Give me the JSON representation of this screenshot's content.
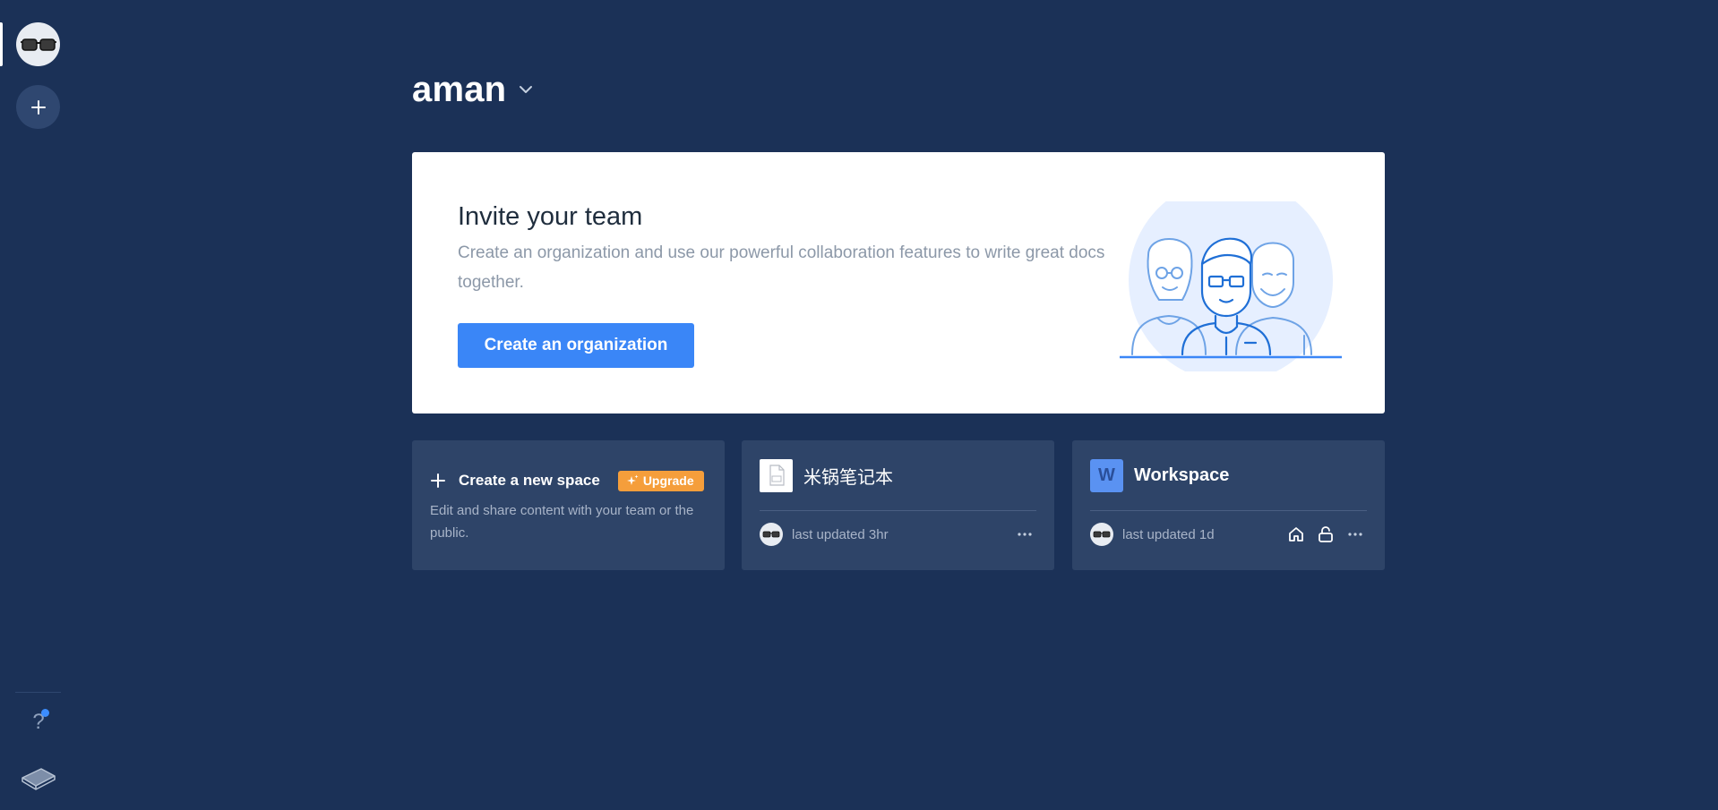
{
  "workspace": {
    "name": "aman"
  },
  "invite": {
    "title": "Invite your team",
    "description": "Create an organization and use our powerful collaboration features to write great docs together.",
    "button_label": "Create an organization"
  },
  "new_space": {
    "title": "Create a new space",
    "upgrade_label": "Upgrade",
    "description": "Edit and share content with your team or the public."
  },
  "spaces": [
    {
      "title": "米锅笔记本",
      "icon": "document-icon",
      "updated": "last updated 3hr"
    },
    {
      "title": "Workspace",
      "icon_letter": "W",
      "updated": "last updated 1d"
    }
  ],
  "rail": {
    "help_label": "?"
  },
  "colors": {
    "background": "#1b3157",
    "card": "#2e4468",
    "primary_button": "#3a86f7",
    "upgrade_badge": "#f59e3b",
    "notification_dot": "#3c8dff"
  }
}
